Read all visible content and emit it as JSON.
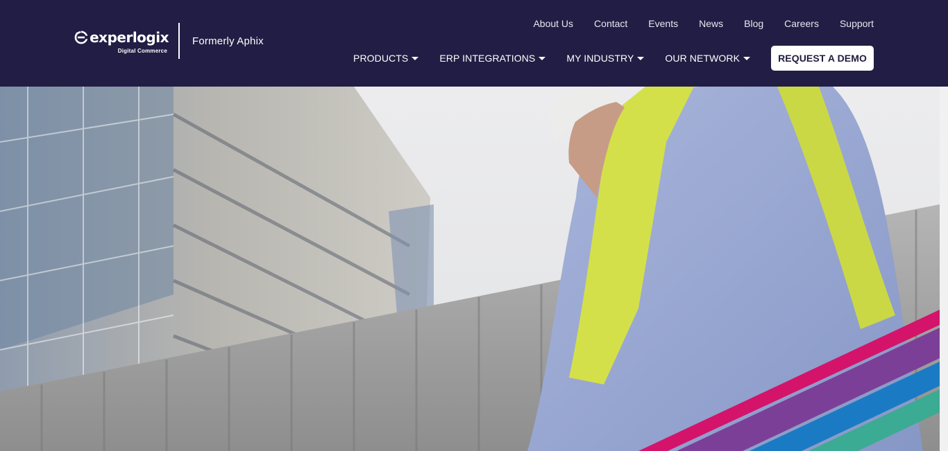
{
  "brand": {
    "logo_text": "experlogix",
    "logo_subtext": "Digital Commerce",
    "formerly": "Formerly Aphix"
  },
  "top_links": [
    "About Us",
    "Contact",
    "Events",
    "News",
    "Blog",
    "Careers",
    "Support"
  ],
  "main_nav": {
    "items": [
      "PRODUCTS",
      "ERP INTEGRATIONS",
      "MY INDUSTRY",
      "OUR NETWORK"
    ],
    "cta": "REQUEST A DEMO"
  },
  "hero": {
    "image": "construction-worker-photo",
    "stripe_colors": [
      "#d4136a",
      "#7c3f98",
      "#1a7bc4",
      "#3bab93"
    ]
  },
  "colors": {
    "header_bg": "#221d44",
    "cta_bg": "#ffffff",
    "cta_text": "#1f1b3f"
  }
}
